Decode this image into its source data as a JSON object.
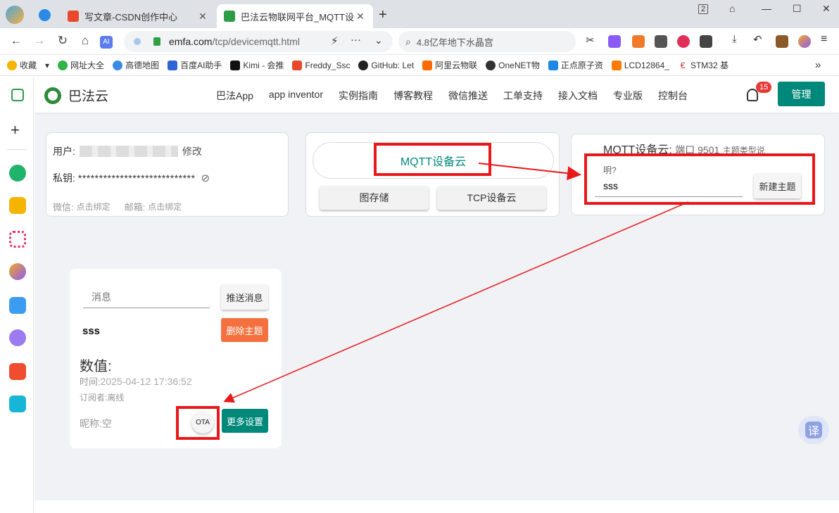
{
  "browser": {
    "tabs": [
      {
        "title": "写文章-CSDN创作中心",
        "favicon_color": "#e8492b",
        "active": false
      },
      {
        "title": "巴法云物联网平台_MQTT设备",
        "favicon_color": "#2e9b47",
        "active": true
      }
    ],
    "tab_count": "2",
    "url_host": "emfa.com",
    "url_path": "/tcp/devicemqtt.html",
    "search_text": "4.8亿年地下水晶宫",
    "bookmarks": [
      "收藏",
      "网址大全",
      "高德地图",
      "百度AI助手",
      "Kimi - 会推",
      "Freddy_Ssc",
      "GitHub: Let",
      "阿里云物联",
      "OneNET物",
      "正点原子资",
      "LCD12864_",
      "STM32 基"
    ],
    "more_bookmarks": "»"
  },
  "site": {
    "logo_text": "巴法云",
    "menu": [
      "巴法App",
      "app inventor",
      "实例指南",
      "博客教程",
      "微信推送",
      "工单支持",
      "接入文档",
      "专业版",
      "控制台"
    ],
    "notification_count": "15",
    "admin_label": "管理"
  },
  "user_card": {
    "user_label": "用户:",
    "edit_label": "修改",
    "key_label": "私钥:",
    "key_value": "****************************",
    "wechat_label": "微信:",
    "wechat_value": "点击绑定",
    "email_label": "邮箱:",
    "email_value": "点击绑定"
  },
  "cloud_selector": {
    "mqtt_label": "MQTT设备云",
    "image_storage_label": "图存储",
    "tcp_label": "TCP设备云"
  },
  "topic_creator": {
    "title": "MQTT设备云:",
    "port": "端口 9501",
    "explain": "主题类型说",
    "floating_label": "明?",
    "topic_value": "sss",
    "create_label": "新建主题"
  },
  "device_card": {
    "message_placeholder": "消息",
    "push_label": "推送消息",
    "topic_name": "sss",
    "delete_label": "删除主题",
    "value_label": "数值:",
    "time_label": "时间:",
    "time_value": "2025-04-12 17:36:52",
    "subscriber_label": "订阅者:",
    "subscriber_value": "离线",
    "nickname_label": "昵称:",
    "nickname_value": "空",
    "ota_label": "OTA",
    "more_label": "更多设置"
  },
  "translate_label": "译",
  "colors": {
    "accent": "#00897b",
    "danger": "#f4713f",
    "annotation": "#e8181b",
    "logo_green": "#2e8b3a"
  }
}
